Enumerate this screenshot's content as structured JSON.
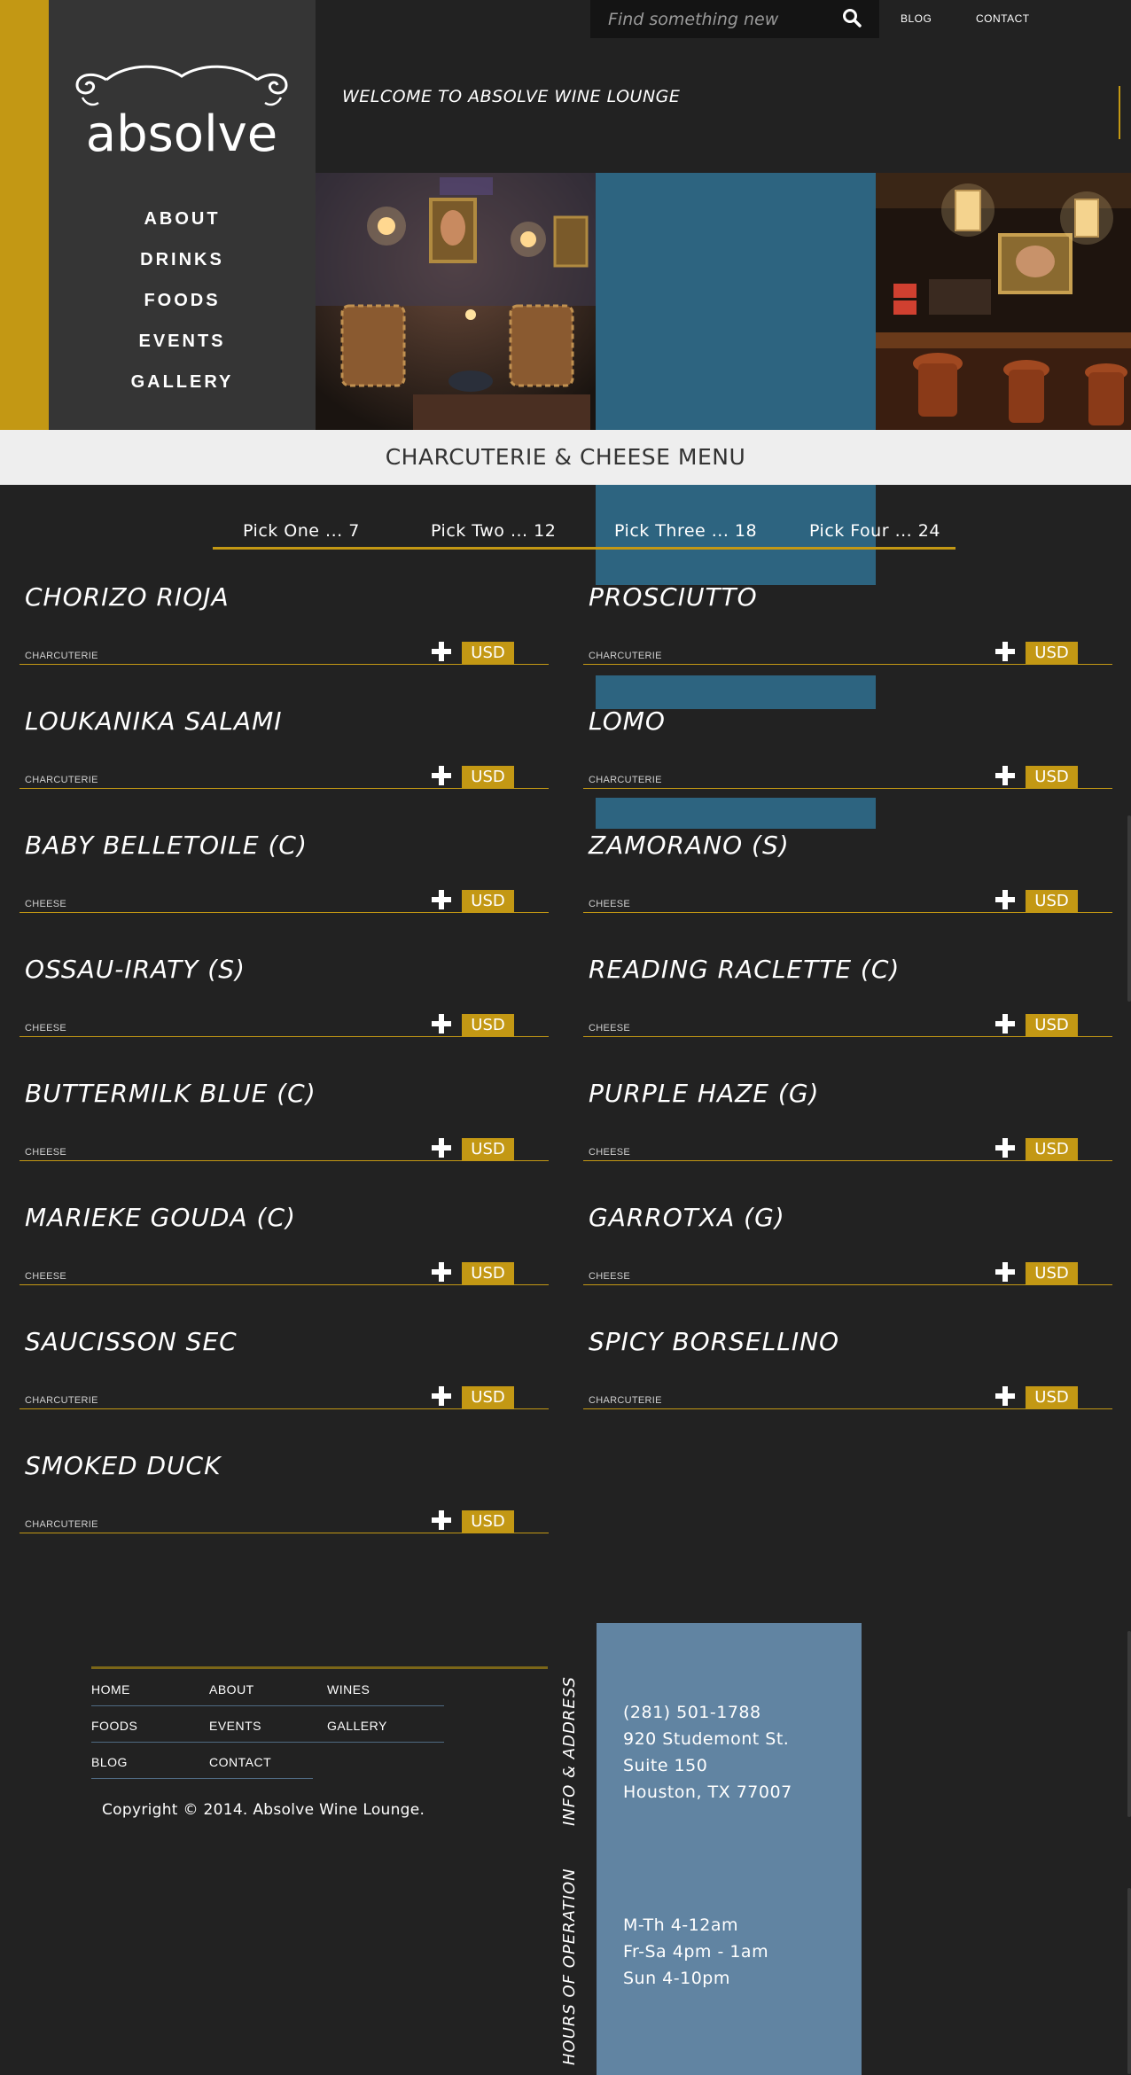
{
  "brand": {
    "logo_text": "absolve",
    "accent_color": "#c39814",
    "panel_blue": "#2d6480",
    "footer_blue": "#6184a2"
  },
  "search": {
    "placeholder": "Find something new",
    "icon": "search-icon"
  },
  "top_links": {
    "blog": "BLOG",
    "contact": "CONTACT"
  },
  "welcome": "WELCOME TO ABSOLVE WINE LOUNGE",
  "main_nav": [
    "ABOUT",
    "DRINKS",
    "FOODS",
    "EVENTS",
    "GALLERY"
  ],
  "menu_title": "CHARCUTERIE & CHEESE MENU",
  "pick_tabs": [
    "Pick One ... 7",
    "Pick Two ... 12",
    "Pick Three ... 18",
    "Pick Four ... 24"
  ],
  "price_label": "USD",
  "items": [
    {
      "name": "CHORIZO RIOJA",
      "category": "CHARCUTERIE"
    },
    {
      "name": "PROSCIUTTO",
      "category": "CHARCUTERIE"
    },
    {
      "name": "LOUKANIKA SALAMI",
      "category": "CHARCUTERIE"
    },
    {
      "name": "LOMO",
      "category": "CHARCUTERIE"
    },
    {
      "name": "BABY BELLETOILE (C)",
      "category": "CHEESE"
    },
    {
      "name": "ZAMORANO (S)",
      "category": "CHEESE"
    },
    {
      "name": "OSSAU-IRATY (S)",
      "category": "CHEESE"
    },
    {
      "name": "READING RACLETTE (C)",
      "category": "CHEESE"
    },
    {
      "name": "BUTTERMILK BLUE (C)",
      "category": "CHEESE"
    },
    {
      "name": "PURPLE HAZE (G)",
      "category": "CHEESE"
    },
    {
      "name": "MARIEKE GOUDA (C)",
      "category": "CHEESE"
    },
    {
      "name": "GARROTXA (G)",
      "category": "CHEESE"
    },
    {
      "name": "SAUCISSON SEC",
      "category": "CHARCUTERIE"
    },
    {
      "name": "SPICY BORSELLINO",
      "category": "CHARCUTERIE"
    },
    {
      "name": "SMOKED DUCK",
      "category": "CHARCUTERIE"
    }
  ],
  "footer": {
    "nav": {
      "home": "HOME",
      "about": "ABOUT",
      "wines": "WINES",
      "foods": "FOODS",
      "events": "EVENTS",
      "gallery": "GALLERY",
      "blog": "BLOG",
      "contact": "CONTACT"
    },
    "copyright": "Copyright © 2014. Absolve Wine Lounge.",
    "info_label": "INFO & ADDRESS",
    "hours_label": "HOURS OF OPERATION",
    "info_lines": [
      "(281) 501-1788",
      "920 Studemont St.",
      "Suite 150",
      "Houston, TX 77007"
    ],
    "hours_lines": [
      "M-Th 4-12am",
      "Fr-Sa 4pm - 1am",
      "Sun 4-10pm"
    ]
  }
}
